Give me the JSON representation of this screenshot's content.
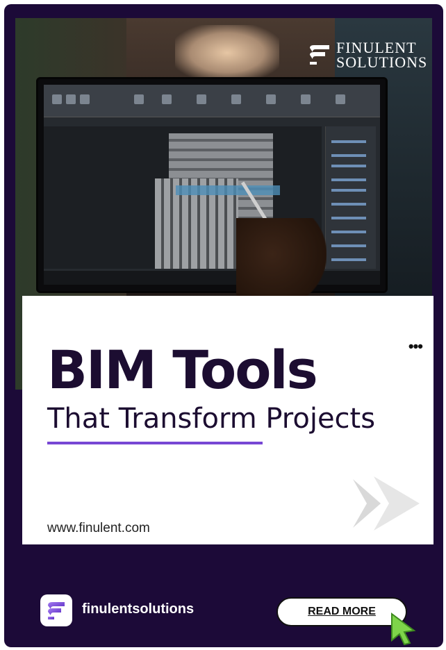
{
  "brand": {
    "logo_line1": "FINULENT",
    "logo_line2": "SOLUTIONS",
    "accent_color": "#7747d4",
    "background_color": "#1c0a38"
  },
  "post": {
    "headline": "BIM Tools",
    "subheadline": "That Transform Projects",
    "website": "www.finulent.com",
    "more_icon": "more-horizontal-icon"
  },
  "footer": {
    "account_handle": "finulentsolutions",
    "cta_label": "READ MORE"
  }
}
